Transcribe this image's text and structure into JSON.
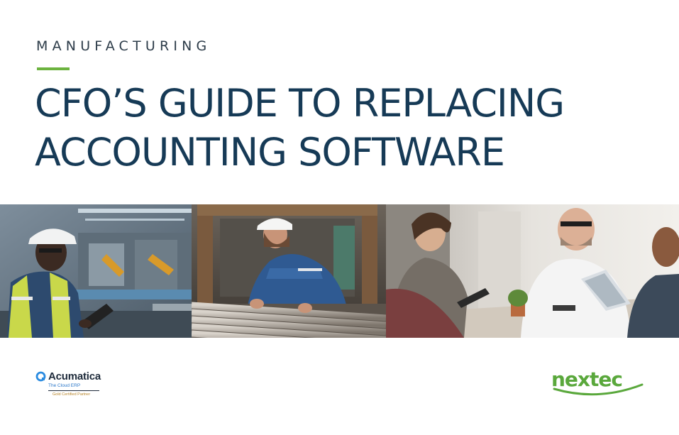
{
  "header": {
    "kicker": "MANUFACTURING",
    "title_line1": "CFO’S GUIDE TO REPLACING",
    "title_line2": "ACCOUNTING SOFTWARE"
  },
  "photos": [
    {
      "subject": "worker in hard hat and safety vest using tablet in factory"
    },
    {
      "subject": "worker in blue coveralls and hard hat inspecting metal pipes"
    },
    {
      "subject": "business team meeting at table with tablets and laptops"
    }
  ],
  "logos": {
    "acumatica": {
      "name": "Acumatica",
      "tagline": "The Cloud ERP",
      "partner": "Gold Certified Partner"
    },
    "nextec": {
      "name": "nextec"
    }
  },
  "colors": {
    "title": "#163a56",
    "accent_green": "#6cb33f",
    "nextec_green": "#5aa83c",
    "acumatica_blue": "#2a77c9"
  }
}
